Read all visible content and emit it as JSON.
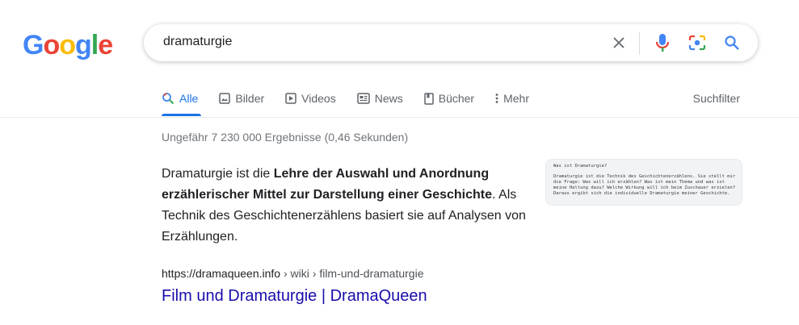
{
  "logo": {
    "letters": [
      "G",
      "o",
      "o",
      "g",
      "l",
      "e"
    ],
    "colors": [
      "#4285F4",
      "#EA4335",
      "#FBBC05",
      "#4285F4",
      "#34A853",
      "#EA4335"
    ]
  },
  "search": {
    "query": "dramaturgie"
  },
  "icons": {
    "clear": "close-icon",
    "voice": "mic-icon",
    "lens": "camera-icon",
    "search": "search-icon"
  },
  "tabs": [
    {
      "label": "Alle",
      "icon": "search-icon",
      "active": true
    },
    {
      "label": "Bilder",
      "icon": "image-icon"
    },
    {
      "label": "Videos",
      "icon": "play-icon"
    },
    {
      "label": "News",
      "icon": "news-icon"
    },
    {
      "label": "Bücher",
      "icon": "book-icon"
    },
    {
      "label": "Mehr",
      "icon": "more-vert-icon"
    }
  ],
  "suchfilter": "Suchfilter",
  "stats": "Ungefähr 7 230 000 Ergebnisse (0,46 Sekunden)",
  "snippet": {
    "pre": "Dramaturgie ist die ",
    "bold": "Lehre der Auswahl und Anordnung erzählerischer Mittel zur Darstellung einer Geschichte",
    "post": ". Als Technik des Geschichtenerzählens basiert sie auf Analysen von Erzählungen."
  },
  "thumbnail": {
    "title": "Was ist Dramaturgie?",
    "body": "Dramaturgie ist die Technik des Geschichtenerzählens. Sie stellt mir die Frage: Was will ich erzählen? Was ist mein Thema und was ist meine Haltung dazu? Welche Wirkung will ich beim Zuschauer erzielen? Daraus ergibt sich die individuelle Dramaturgie meiner Geschichte."
  },
  "result": {
    "domain": "https://dramaqueen.info",
    "path": " › wiki › film-und-dramaturgie",
    "title": "Film und Dramaturgie | DramaQueen"
  },
  "colors": {
    "accent": "#1a73e8",
    "link": "#1a0dab"
  }
}
